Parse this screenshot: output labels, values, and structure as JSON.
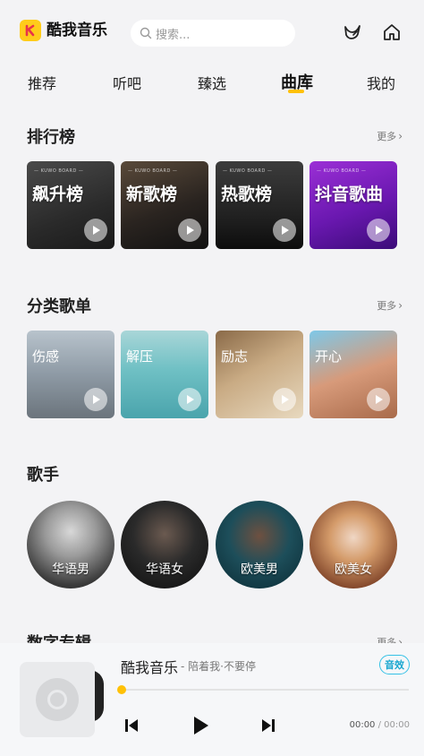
{
  "app": {
    "name": "酷我音乐"
  },
  "search": {
    "placeholder": "搜索..."
  },
  "tabs": [
    {
      "label": "推荐"
    },
    {
      "label": "听吧"
    },
    {
      "label": "臻选"
    },
    {
      "label": "曲库",
      "active": true
    },
    {
      "label": "我的"
    }
  ],
  "sections": {
    "charts": {
      "title": "排行榜",
      "more": "更多"
    },
    "categories": {
      "title": "分类歌单",
      "more": "更多"
    },
    "singers": {
      "title": "歌手"
    },
    "albums": {
      "title": "数字专辑",
      "more": "更多"
    }
  },
  "charts": [
    {
      "label": "飙升榜",
      "tag": "— KUWO BOARD —"
    },
    {
      "label": "新歌榜",
      "tag": "— KUWO BOARD —"
    },
    {
      "label": "热歌榜",
      "tag": "— KUWO BOARD —"
    },
    {
      "label": "抖音歌曲",
      "tag": "— KUWO BOARD —"
    }
  ],
  "categories": [
    {
      "label": "伤感"
    },
    {
      "label": "解压"
    },
    {
      "label": "励志"
    },
    {
      "label": "开心"
    }
  ],
  "singers": [
    {
      "label": "华语男"
    },
    {
      "label": "华语女"
    },
    {
      "label": "欧美男"
    },
    {
      "label": "欧美女"
    }
  ],
  "player": {
    "title": "酷我音乐",
    "subtitle": "- 陪着我·不要停",
    "badge": "音效",
    "elapsed": "00:00",
    "separator": "/",
    "duration": "00:00",
    "progress": 0
  },
  "colors": {
    "accent": "#ffc107",
    "badge": "#35c1e6",
    "logo": "#ffcc1a"
  }
}
